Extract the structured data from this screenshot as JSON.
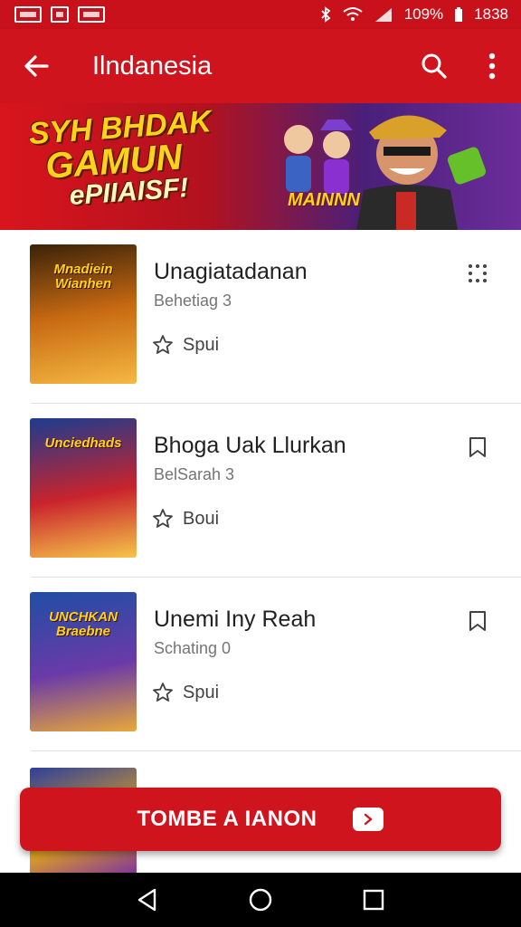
{
  "status_bar": {
    "battery": "109%",
    "time": "1838"
  },
  "app_bar": {
    "title": "Ilndanesia"
  },
  "banner": {
    "line1": "SYH BHDAK",
    "line2": "GAMUN",
    "line3": "ePIIAISF!",
    "logo": "MAINNN"
  },
  "items": [
    {
      "title": "Unagiatadanan",
      "subtitle": "Behetiag 3",
      "rating_label": "Spui",
      "thumb_label": "Mnadiein Wianhen",
      "action_icon": "more-grid-icon",
      "colors": [
        "#3a2208",
        "#c86a12",
        "#f5b942"
      ]
    },
    {
      "title": "Bhoga Uak Llurkan",
      "subtitle": "BelSarah 3",
      "rating_label": "Boui",
      "thumb_label": "Unciedhads",
      "action_icon": "bookmark-icon",
      "colors": [
        "#1b3c8f",
        "#c9232c",
        "#f6c54a"
      ]
    },
    {
      "title": "Unemi Iny Reah",
      "subtitle": "Schating 0",
      "rating_label": "Spui",
      "thumb_label": "UNCHKAN Braebne",
      "action_icon": "bookmark-icon",
      "colors": [
        "#1f4ea5",
        "#6a3aa8",
        "#e7a83a"
      ]
    }
  ],
  "cta": {
    "label": "TOMBE A IANON"
  },
  "colors": {
    "primary": "#d0141d",
    "status": "#c8111a"
  }
}
